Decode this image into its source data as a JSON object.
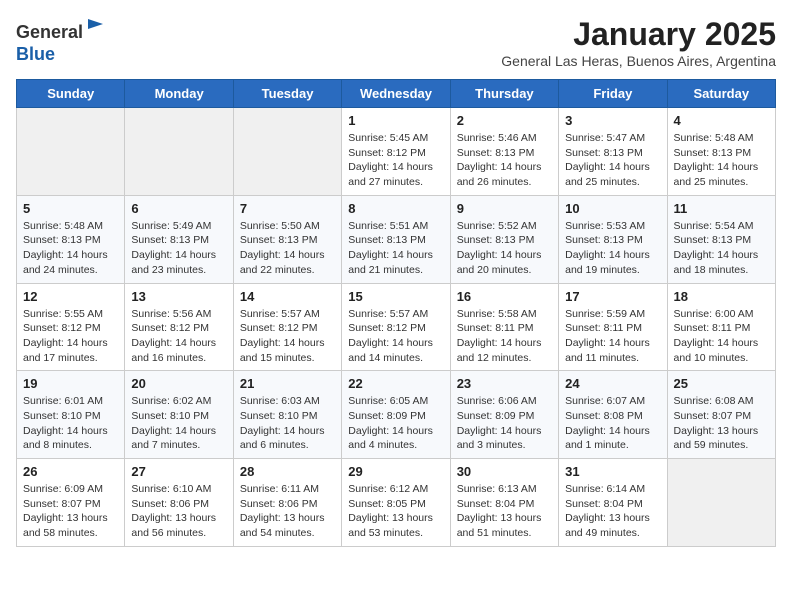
{
  "logo": {
    "general": "General",
    "blue": "Blue"
  },
  "title": "January 2025",
  "subtitle": "General Las Heras, Buenos Aires, Argentina",
  "days_of_week": [
    "Sunday",
    "Monday",
    "Tuesday",
    "Wednesday",
    "Thursday",
    "Friday",
    "Saturday"
  ],
  "weeks": [
    [
      {
        "day": "",
        "info": ""
      },
      {
        "day": "",
        "info": ""
      },
      {
        "day": "",
        "info": ""
      },
      {
        "day": "1",
        "info": "Sunrise: 5:45 AM\nSunset: 8:12 PM\nDaylight: 14 hours\nand 27 minutes."
      },
      {
        "day": "2",
        "info": "Sunrise: 5:46 AM\nSunset: 8:13 PM\nDaylight: 14 hours\nand 26 minutes."
      },
      {
        "day": "3",
        "info": "Sunrise: 5:47 AM\nSunset: 8:13 PM\nDaylight: 14 hours\nand 25 minutes."
      },
      {
        "day": "4",
        "info": "Sunrise: 5:48 AM\nSunset: 8:13 PM\nDaylight: 14 hours\nand 25 minutes."
      }
    ],
    [
      {
        "day": "5",
        "info": "Sunrise: 5:48 AM\nSunset: 8:13 PM\nDaylight: 14 hours\nand 24 minutes."
      },
      {
        "day": "6",
        "info": "Sunrise: 5:49 AM\nSunset: 8:13 PM\nDaylight: 14 hours\nand 23 minutes."
      },
      {
        "day": "7",
        "info": "Sunrise: 5:50 AM\nSunset: 8:13 PM\nDaylight: 14 hours\nand 22 minutes."
      },
      {
        "day": "8",
        "info": "Sunrise: 5:51 AM\nSunset: 8:13 PM\nDaylight: 14 hours\nand 21 minutes."
      },
      {
        "day": "9",
        "info": "Sunrise: 5:52 AM\nSunset: 8:13 PM\nDaylight: 14 hours\nand 20 minutes."
      },
      {
        "day": "10",
        "info": "Sunrise: 5:53 AM\nSunset: 8:13 PM\nDaylight: 14 hours\nand 19 minutes."
      },
      {
        "day": "11",
        "info": "Sunrise: 5:54 AM\nSunset: 8:13 PM\nDaylight: 14 hours\nand 18 minutes."
      }
    ],
    [
      {
        "day": "12",
        "info": "Sunrise: 5:55 AM\nSunset: 8:12 PM\nDaylight: 14 hours\nand 17 minutes."
      },
      {
        "day": "13",
        "info": "Sunrise: 5:56 AM\nSunset: 8:12 PM\nDaylight: 14 hours\nand 16 minutes."
      },
      {
        "day": "14",
        "info": "Sunrise: 5:57 AM\nSunset: 8:12 PM\nDaylight: 14 hours\nand 15 minutes."
      },
      {
        "day": "15",
        "info": "Sunrise: 5:57 AM\nSunset: 8:12 PM\nDaylight: 14 hours\nand 14 minutes."
      },
      {
        "day": "16",
        "info": "Sunrise: 5:58 AM\nSunset: 8:11 PM\nDaylight: 14 hours\nand 12 minutes."
      },
      {
        "day": "17",
        "info": "Sunrise: 5:59 AM\nSunset: 8:11 PM\nDaylight: 14 hours\nand 11 minutes."
      },
      {
        "day": "18",
        "info": "Sunrise: 6:00 AM\nSunset: 8:11 PM\nDaylight: 14 hours\nand 10 minutes."
      }
    ],
    [
      {
        "day": "19",
        "info": "Sunrise: 6:01 AM\nSunset: 8:10 PM\nDaylight: 14 hours\nand 8 minutes."
      },
      {
        "day": "20",
        "info": "Sunrise: 6:02 AM\nSunset: 8:10 PM\nDaylight: 14 hours\nand 7 minutes."
      },
      {
        "day": "21",
        "info": "Sunrise: 6:03 AM\nSunset: 8:10 PM\nDaylight: 14 hours\nand 6 minutes."
      },
      {
        "day": "22",
        "info": "Sunrise: 6:05 AM\nSunset: 8:09 PM\nDaylight: 14 hours\nand 4 minutes."
      },
      {
        "day": "23",
        "info": "Sunrise: 6:06 AM\nSunset: 8:09 PM\nDaylight: 14 hours\nand 3 minutes."
      },
      {
        "day": "24",
        "info": "Sunrise: 6:07 AM\nSunset: 8:08 PM\nDaylight: 14 hours\nand 1 minute."
      },
      {
        "day": "25",
        "info": "Sunrise: 6:08 AM\nSunset: 8:07 PM\nDaylight: 13 hours\nand 59 minutes."
      }
    ],
    [
      {
        "day": "26",
        "info": "Sunrise: 6:09 AM\nSunset: 8:07 PM\nDaylight: 13 hours\nand 58 minutes."
      },
      {
        "day": "27",
        "info": "Sunrise: 6:10 AM\nSunset: 8:06 PM\nDaylight: 13 hours\nand 56 minutes."
      },
      {
        "day": "28",
        "info": "Sunrise: 6:11 AM\nSunset: 8:06 PM\nDaylight: 13 hours\nand 54 minutes."
      },
      {
        "day": "29",
        "info": "Sunrise: 6:12 AM\nSunset: 8:05 PM\nDaylight: 13 hours\nand 53 minutes."
      },
      {
        "day": "30",
        "info": "Sunrise: 6:13 AM\nSunset: 8:04 PM\nDaylight: 13 hours\nand 51 minutes."
      },
      {
        "day": "31",
        "info": "Sunrise: 6:14 AM\nSunset: 8:04 PM\nDaylight: 13 hours\nand 49 minutes."
      },
      {
        "day": "",
        "info": ""
      }
    ]
  ]
}
